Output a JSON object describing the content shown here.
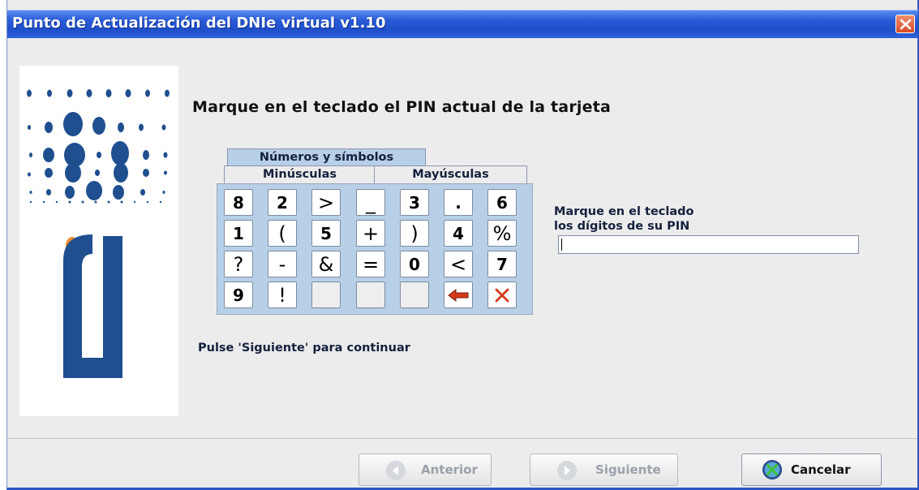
{
  "window": {
    "title": "Punto de Actualización del DNIe virtual v1.10",
    "close_label": "✕"
  },
  "logo": {
    "text": "dni"
  },
  "main": {
    "instruction": "Marque en el teclado el PIN actual de la tarjeta",
    "continue_hint": "Pulse 'Siguiente' para continuar"
  },
  "keyboard": {
    "tabs": [
      {
        "label": "Números y símbolos",
        "active": true
      },
      {
        "label": "Minúsculas",
        "active": false
      },
      {
        "label": "Mayúsculas",
        "active": false
      }
    ],
    "keys": [
      [
        "8",
        "2",
        ">",
        "_",
        "3",
        ".",
        "6"
      ],
      [
        "1",
        "(",
        "5",
        "+",
        ")",
        "4",
        "%"
      ],
      [
        "?",
        "-",
        "&",
        "=",
        "0",
        "<",
        "7"
      ],
      [
        "9",
        "!",
        "",
        "",
        "",
        "backspace-icon",
        "clear-icon"
      ]
    ]
  },
  "pin": {
    "label_line1": "Marque en el teclado",
    "label_line2": "los dígitos de su PIN",
    "value": ""
  },
  "buttons": {
    "previous": "Anterior",
    "next": "Siguiente",
    "cancel": "Cancelar"
  },
  "colors": {
    "titlebar": "#2a5bd8",
    "keypad_bg": "#b8cfe8",
    "logo_dots": "#1f4f8f",
    "logo_orange": "#f08a2c"
  }
}
